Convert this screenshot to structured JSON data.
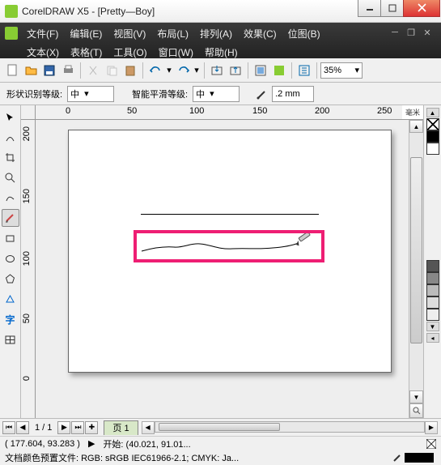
{
  "title": "CorelDRAW X5 - [Pretty—Boy]",
  "menus": {
    "file": "文件(F)",
    "edit": "编辑(E)",
    "view": "视图(V)",
    "layout": "布局(L)",
    "arrange": "排列(A)",
    "effect": "效果(C)",
    "bitmap": "位图(B)",
    "text": "文本(X)",
    "table": "表格(T)",
    "tools": "工具(O)",
    "window": "窗口(W)",
    "help": "帮助(H)"
  },
  "zoom": "35%",
  "propbar": {
    "shape_label": "形状识别等级:",
    "shape_value": "中",
    "smooth_label": "智能平滑等级:",
    "smooth_value": "中",
    "stroke": ".2 mm"
  },
  "ruler": {
    "unit": "毫米",
    "h": [
      "0",
      "50",
      "100",
      "150",
      "200",
      "250"
    ],
    "v": [
      "200",
      "150",
      "100",
      "50",
      "0"
    ]
  },
  "pages": {
    "count": "1 / 1",
    "tab": "页 1"
  },
  "status": {
    "coords": "( 177.604, 93.283 )",
    "start": "开始: (40.021, 91.01...",
    "colorprofile": "文档颜色预置文件: RGB: sRGB IEC61966-2.1; CMYK: Ja..."
  },
  "palette": [
    "#000",
    "#fff",
    "#555",
    "#888",
    "#bbb",
    "#ddd",
    "#eee"
  ],
  "chart_data": null
}
